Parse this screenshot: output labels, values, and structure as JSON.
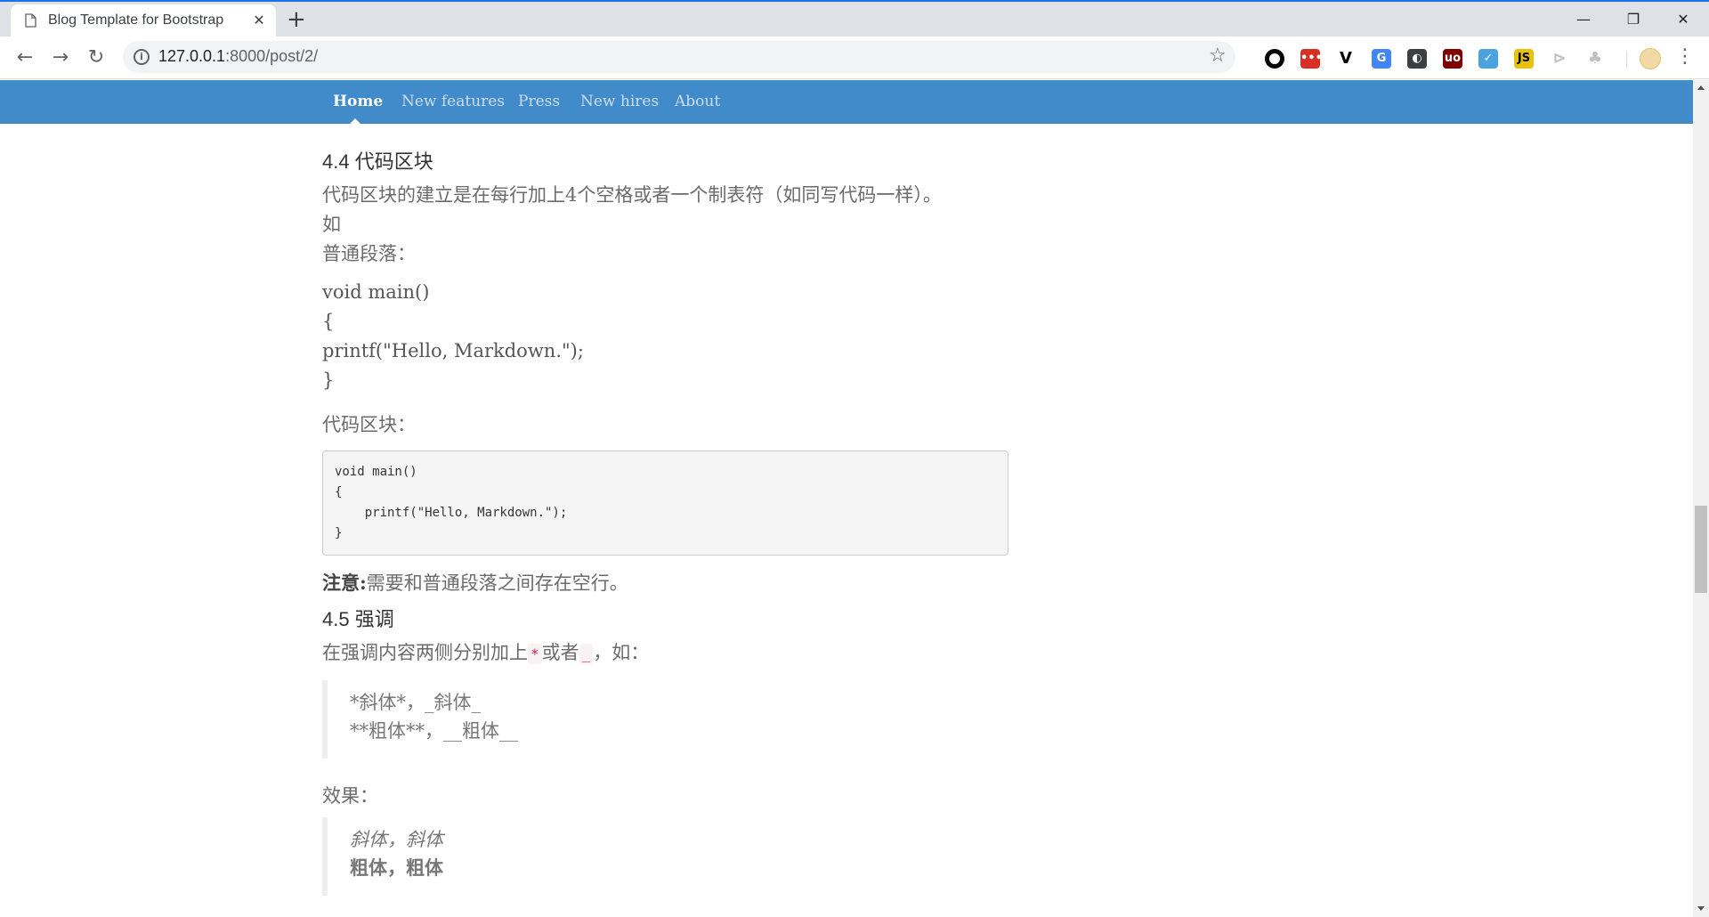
{
  "browser": {
    "tab_title": "Blog Template for Bootstrap",
    "tab_close": "✕",
    "new_tab": "+",
    "url_host": "127.0.0.1",
    "url_rest": ":8000/post/2/",
    "window_min": "—",
    "window_max": "❐",
    "window_close": "✕",
    "back": "←",
    "forward": "→",
    "reload": "↻",
    "star": "☆",
    "menu": "⋮",
    "extensions": [
      {
        "name": "circle-extension-icon",
        "glyph": "",
        "color": "#000000"
      },
      {
        "name": "dots-extension-icon",
        "glyph": "•••",
        "color": "#d93025"
      },
      {
        "name": "v-extension-icon",
        "glyph": "V",
        "color": "#000000"
      },
      {
        "name": "translate-extension-icon",
        "glyph": "G",
        "color": "#4285f4"
      },
      {
        "name": "lightbulb-extension-icon",
        "glyph": "◐",
        "color": "#3c4043"
      },
      {
        "name": "ublock-extension-icon",
        "glyph": "uo",
        "color": "#800000"
      },
      {
        "name": "check-extension-icon",
        "glyph": "✓",
        "color": "#4aa3df"
      },
      {
        "name": "js-extension-icon",
        "glyph": "JS",
        "color": "#e8c20a"
      },
      {
        "name": "cursor-extension-icon",
        "glyph": "⊳",
        "color": "#c0c0c0"
      },
      {
        "name": "tree-extension-icon",
        "glyph": "♣",
        "color": "#c0c0c0"
      }
    ]
  },
  "navbar": {
    "items": [
      "Home",
      "New features",
      "Press",
      "New hires",
      "About"
    ]
  },
  "article": {
    "h_code": "4.4 代码区块",
    "p_code_intro": "代码区块的建立是在每行加上4个空格或者一个制表符（如同写代码一样）。",
    "p_ru": "如",
    "p_normal": "普通段落：",
    "plain_code": [
      "void main()",
      "{",
      "printf(\"Hello, Markdown.\");",
      "}"
    ],
    "p_block_label": "代码区块：",
    "code_block": "void main()\n{\n    printf(\"Hello, Markdown.\");\n}",
    "note_label": "注意:",
    "note_text": "需要和普通段落之间存在空行。",
    "h_emphasis": "4.5 强调",
    "emph_before": "在强调内容两侧分别加上",
    "emph_star": "*",
    "emph_mid": "或者",
    "emph_underscore": "_",
    "emph_after": "，如：",
    "quote_src": [
      "*斜体*，_斜体_",
      "**粗体**，__粗体__"
    ],
    "p_effect": "效果：",
    "quote_italic": "斜体，斜体",
    "quote_bold": "粗体，粗体"
  },
  "colors": {
    "navbar": "#428bca",
    "chrome_tabstrip": "#dee1e6",
    "accent": "#1a73e8"
  }
}
